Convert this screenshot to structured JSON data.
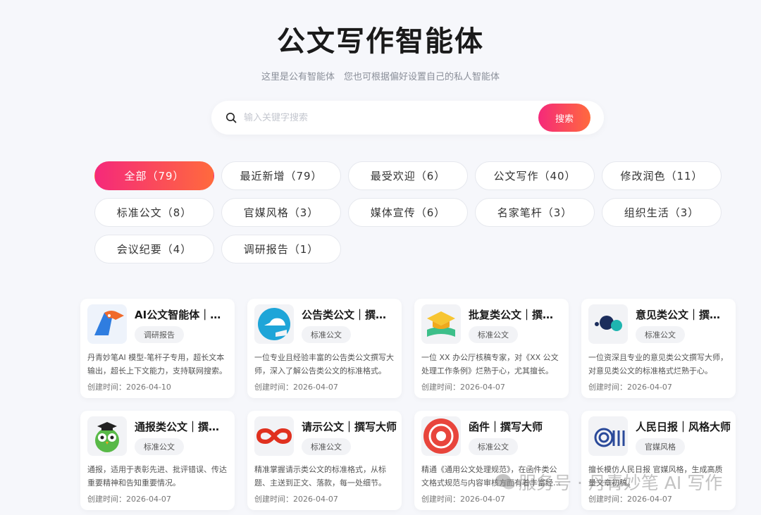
{
  "header": {
    "title": "公文写作智能体",
    "subtitle": "这里是公有智能体　您也可根据偏好设置自己的私人智能体"
  },
  "search": {
    "placeholder": "输入关键字搜索",
    "button_label": "搜索"
  },
  "filters": [
    {
      "label": "全部（79）",
      "active": true
    },
    {
      "label": "最近新增（79）",
      "active": false
    },
    {
      "label": "最受欢迎（6）",
      "active": false
    },
    {
      "label": "公文写作（40）",
      "active": false
    },
    {
      "label": "修改润色（11）",
      "active": false
    },
    {
      "label": "标准公文（8）",
      "active": false
    },
    {
      "label": "官媒风格（3）",
      "active": false
    },
    {
      "label": "媒体宣传（6）",
      "active": false
    },
    {
      "label": "名家笔杆（3）",
      "active": false
    },
    {
      "label": "组织生活（3）",
      "active": false
    },
    {
      "label": "会议纪要（4）",
      "active": false
    },
    {
      "label": "调研报告（1）",
      "active": false
    }
  ],
  "cards": [
    {
      "name": "AI公文智能体｜撰写大师",
      "tag": "调研报告",
      "desc": "丹青妙笔AI 模型-笔杆子专用，超长文本输出，超长上下文能力，支持联网搜索。",
      "date": "创建时间：2026-04-10",
      "icon": "parrot-icon"
    },
    {
      "name": "公告类公文｜撰写大师",
      "tag": "标准公文",
      "desc": "一位专业且经验丰富的公告类公文撰写大师，深入了解公告类公文的标准格式。",
      "date": "创建时间：2026-04-07",
      "icon": "letter-e-icon"
    },
    {
      "name": "批复类公文｜撰写大师",
      "tag": "标准公文",
      "desc": "一位 XX 办公厅核稿专家，对《XX 公文处理工作条例》烂熟于心，尤其擅长。",
      "date": "创建时间：2026-04-07",
      "icon": "graduation-book-icon"
    },
    {
      "name": "意见类公文｜撰写大师",
      "tag": "标准公文",
      "desc": "一位资深且专业的意见类公文撰写大师，对意见类公文的标准格式烂熟于心。",
      "date": "创建时间：2026-04-07",
      "icon": "dots-icon"
    },
    {
      "name": "通报类公文｜撰写大师",
      "tag": "标准公文",
      "desc": "通报，适用于表彰先进、批评错误、传达重要精神和告知重要情况。",
      "date": "创建时间：2026-04-07",
      "icon": "owl-icon"
    },
    {
      "name": "请示公文｜撰写大师",
      "tag": "标准公文",
      "desc": "精准掌握请示类公文的标准格式，从标题、主送到正文、落款，每一处细节。",
      "date": "创建时间：2026-04-07",
      "icon": "infinity-icon"
    },
    {
      "name": "函件｜撰写大师",
      "tag": "标准公文",
      "desc": "精通《通用公文处理规范》，在函件类公文格式规范与内容审核方面有着丰富经验。",
      "date": "创建时间：2026-04-07",
      "icon": "target-icon"
    },
    {
      "name": "人民日报｜风格大师",
      "tag": "官媒风格",
      "desc": "擅长模仿人民日报 官媒风格，生成高质量文章初稿。",
      "date": "创建时间：2026-04-07",
      "icon": "ai-logo-icon"
    }
  ],
  "watermark": "服务号 · 丹青妙笔 AI 写作"
}
